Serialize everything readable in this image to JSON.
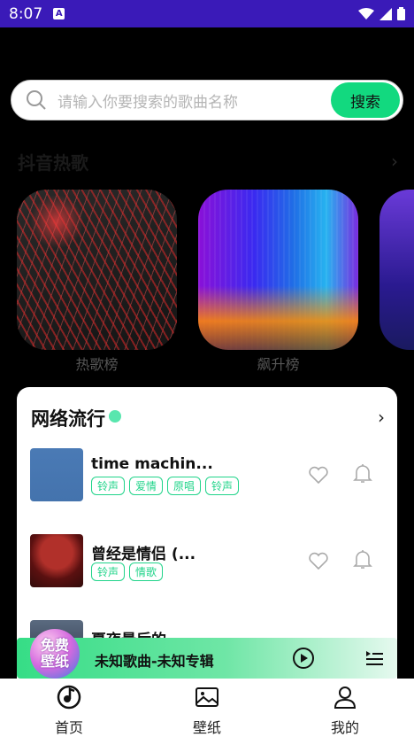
{
  "status": {
    "time": "8:07"
  },
  "search": {
    "placeholder": "请输入你要搜索的歌曲名称",
    "button": "搜索"
  },
  "hot": {
    "title": "抖音热歌",
    "cards": [
      {
        "label": "热歌榜"
      },
      {
        "label": "飙升榜"
      }
    ]
  },
  "panel": {
    "title": "网络流行",
    "songs": [
      {
        "title": "time machin...",
        "tags": [
          "铃声",
          "爱情",
          "原唱",
          "铃声"
        ]
      },
      {
        "title": "曾经是情侣 (...",
        "tags": [
          "铃声",
          "情歌"
        ]
      },
      {
        "title": "夏夜最后的"
      }
    ]
  },
  "player": {
    "badge_line1": "免费",
    "badge_line2": "壁纸",
    "now_playing": "未知歌曲-未知专辑"
  },
  "tabs": [
    {
      "label": "首页"
    },
    {
      "label": "壁纸"
    },
    {
      "label": "我的"
    }
  ],
  "colors": {
    "accent": "#12d97f",
    "statusbar": "#3a1ab8"
  }
}
